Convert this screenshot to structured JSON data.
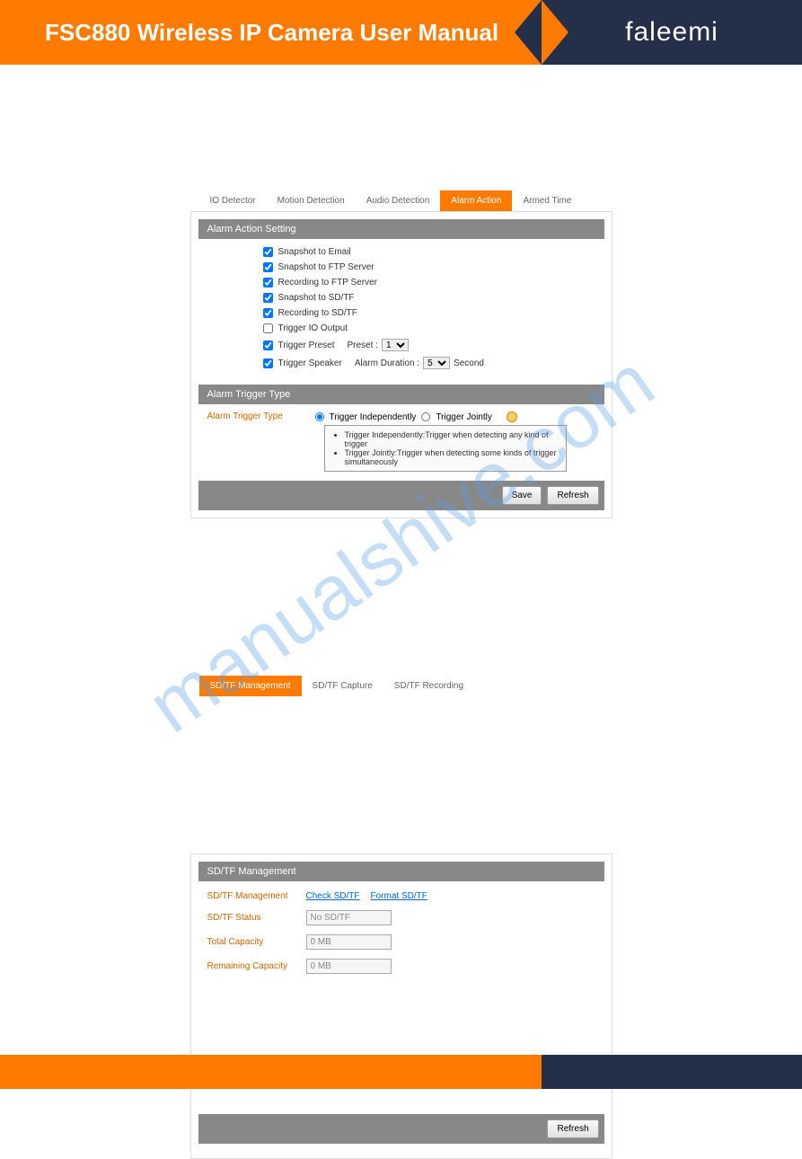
{
  "header": {
    "title": "FSC880 Wireless IP Camera User Manual",
    "logo": "faleemi"
  },
  "watermark": "manualshive.com",
  "panel1": {
    "tabs": [
      {
        "label": "IO Detector",
        "active": false
      },
      {
        "label": "Motion Detection",
        "active": false
      },
      {
        "label": "Audio Detection",
        "active": false
      },
      {
        "label": "Alarm Action",
        "active": true
      },
      {
        "label": "Armed Time",
        "active": false
      }
    ],
    "section1_title": "Alarm Action Setting",
    "checks": [
      {
        "label": "Snapshot to Email",
        "checked": true
      },
      {
        "label": "Snapshot to FTP Server",
        "checked": true
      },
      {
        "label": "Recording to FTP Server",
        "checked": true
      },
      {
        "label": "Snapshot to SD/TF",
        "checked": true
      },
      {
        "label": "Recording to SD/TF",
        "checked": true
      },
      {
        "label": "Trigger IO Output",
        "checked": false
      }
    ],
    "preset_row": {
      "checked": true,
      "label": "Trigger Preset",
      "field_label": "Preset :",
      "value": "1"
    },
    "speaker_row": {
      "checked": true,
      "label": "Trigger Speaker",
      "field_label": "Alarm Duration :",
      "value": "5",
      "unit": "Second"
    },
    "section2_title": "Alarm Trigger Type",
    "trigger": {
      "label": "Alarm Trigger Type",
      "opt1": "Trigger Independently",
      "opt2": "Trigger Jointly",
      "tooltip1": "Trigger Independently:Trigger when detecting any kind of trigger",
      "tooltip2": "Trigger Jointly:Trigger when detecting some kinds of trigger simultaneously"
    },
    "buttons": {
      "save": "Save",
      "refresh": "Refresh"
    }
  },
  "panel2": {
    "tabs": [
      {
        "label": "SD/TF Management",
        "active": true
      },
      {
        "label": "SD/TF Capture",
        "active": false
      },
      {
        "label": "SD/TF Recording",
        "active": false
      }
    ],
    "section_title": "SD/TF Management",
    "rows": {
      "mgmt": {
        "label": "SD/TF Management",
        "link1": "Check SD/TF",
        "link2": "Format SD/TF"
      },
      "status": {
        "label": "SD/TF Status",
        "value": "No SD/TF"
      },
      "total": {
        "label": "Total Capacity",
        "value": "0 MB"
      },
      "remaining": {
        "label": "Remaining Capacity",
        "value": "0 MB"
      }
    },
    "refresh": "Refresh"
  }
}
